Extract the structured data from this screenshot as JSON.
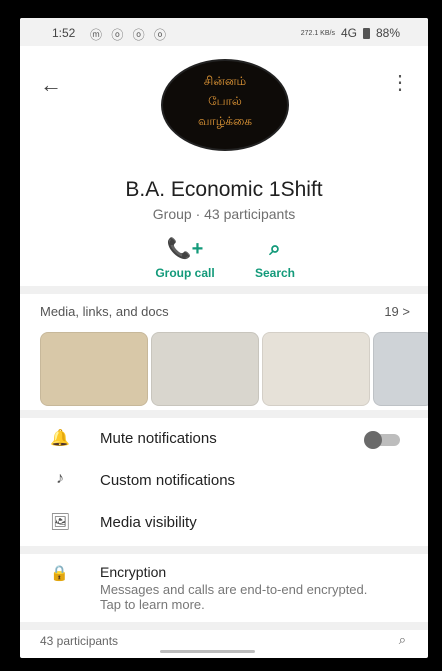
{
  "status_bar": {
    "time": "1:52",
    "left_icons": "ⓜ ⓞ ⓞ ⓞ",
    "network_rate": "272.1\nKB/s",
    "signal": "4G",
    "battery": "88%"
  },
  "header": {
    "group_name": "B.A. Economic 1Shift",
    "group_meta": "Group · 43 participants",
    "actions": {
      "group_call": "Group call",
      "search": "Search"
    },
    "avatar_text": {
      "l1": "சின்னம்",
      "l2": "போல்",
      "l3": "வாழ்க்கை"
    }
  },
  "media": {
    "title": "Media, links, and docs",
    "count": "19 >"
  },
  "settings": {
    "mute_label": "Mute notifications",
    "custom_label": "Custom notifications",
    "visibility_label": "Media visibility"
  },
  "encryption": {
    "title": "Encryption",
    "description": "Messages and calls are end-to-end encrypted. Tap to learn more."
  },
  "participants": {
    "label": "43 participants"
  }
}
